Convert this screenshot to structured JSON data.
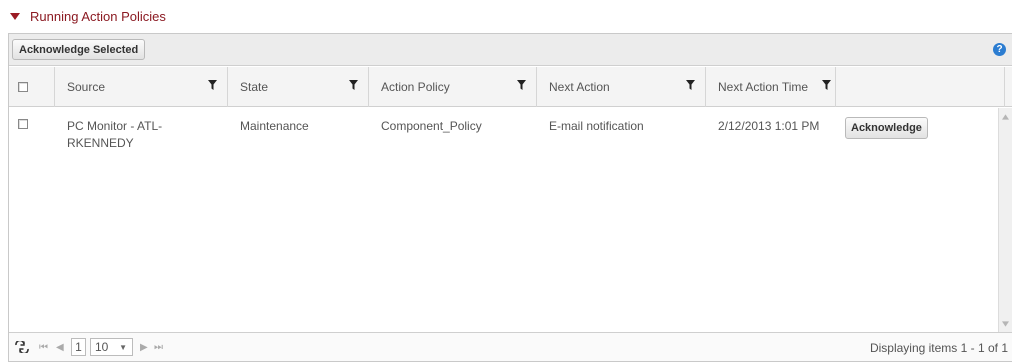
{
  "section": {
    "title": "Running Action Policies"
  },
  "toolbar": {
    "ack_selected_label": "Acknowledge Selected",
    "help_glyph": "?"
  },
  "grid": {
    "columns": [
      "Source",
      "State",
      "Action Policy",
      "Next Action",
      "Next Action Time"
    ],
    "rows": [
      {
        "source": "PC Monitor - ATL-\nRKENNEDY",
        "state": "Maintenance",
        "action_policy": "Component_Policy",
        "next_action": "E-mail notification",
        "next_action_time": "2/12/2013 1:01 PM",
        "action_label": "Acknowledge"
      }
    ]
  },
  "pager": {
    "page": "1",
    "page_size": "10",
    "info": "Displaying items 1 - 1 of 1",
    "first_glyph": "⏮",
    "prev_glyph": "◀",
    "next_glyph": "▶",
    "last_glyph": "⏭"
  },
  "colors": {
    "accent": "#8b1a22",
    "help": "#2c7dd1"
  }
}
